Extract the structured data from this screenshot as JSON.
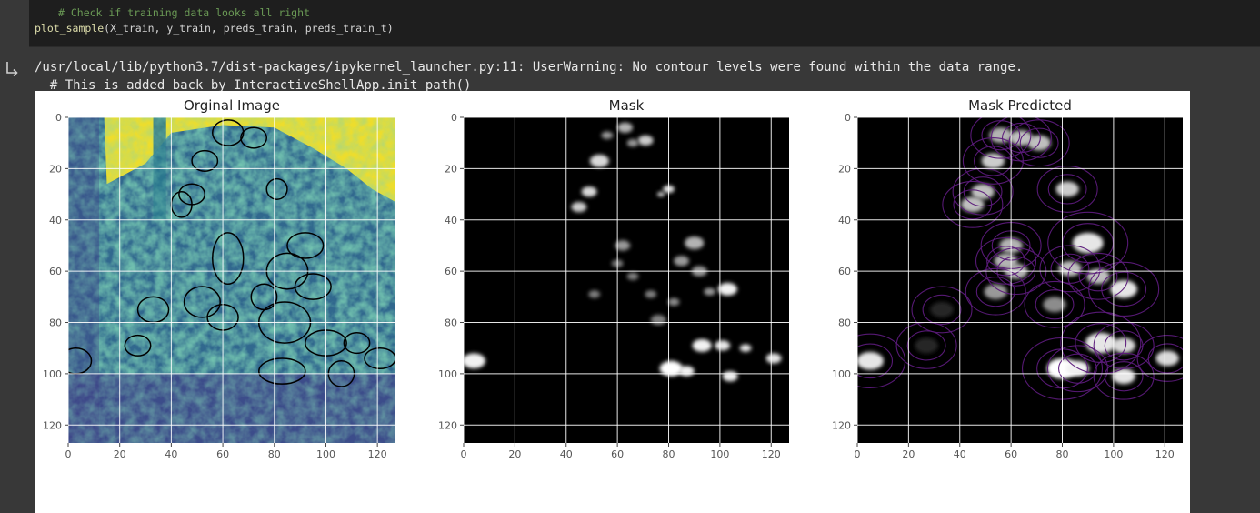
{
  "code": {
    "comment": "# Check if training data looks all right",
    "call_fn": "plot_sample",
    "call_args": "(X_train, y_train, preds_train, preds_train_t)"
  },
  "output": {
    "icon": "output-arrow-icon",
    "warning_line": "/usr/local/lib/python3.7/dist-packages/ipykernel_launcher.py:11: UserWarning: No contour levels were found within the data range.",
    "trace_line": "  # This is added back by InteractiveShellApp.init_path()"
  },
  "colors": {
    "cell_bg": "#1e1e1e",
    "output_bg": "#383838",
    "comment": "#6a9955",
    "viridis_low": "#440154",
    "viridis_mid": "#31688e",
    "viridis_high": "#fde725",
    "contour_purple": "#5b1a7a"
  },
  "chart_data": [
    {
      "type": "heatmap",
      "title": "Orginal Image",
      "colormap": "viridis",
      "xlim": [
        0,
        127
      ],
      "ylim": [
        127,
        0
      ],
      "xticks": [
        0,
        20,
        40,
        60,
        80,
        100,
        120
      ],
      "yticks": [
        0,
        20,
        40,
        60,
        80,
        100,
        120
      ],
      "grid": true,
      "contour_blobs": [
        {
          "x": 62,
          "y": 6,
          "rx": 6,
          "ry": 5
        },
        {
          "x": 72,
          "y": 8,
          "rx": 5,
          "ry": 4
        },
        {
          "x": 53,
          "y": 17,
          "rx": 5,
          "ry": 4
        },
        {
          "x": 48,
          "y": 30,
          "rx": 5,
          "ry": 4
        },
        {
          "x": 44,
          "y": 34,
          "rx": 4,
          "ry": 5
        },
        {
          "x": 81,
          "y": 28,
          "rx": 4,
          "ry": 4
        },
        {
          "x": 62,
          "y": 55,
          "rx": 6,
          "ry": 10
        },
        {
          "x": 92,
          "y": 50,
          "rx": 7,
          "ry": 5
        },
        {
          "x": 85,
          "y": 60,
          "rx": 8,
          "ry": 7
        },
        {
          "x": 52,
          "y": 72,
          "rx": 7,
          "ry": 6
        },
        {
          "x": 60,
          "y": 78,
          "rx": 6,
          "ry": 5
        },
        {
          "x": 33,
          "y": 75,
          "rx": 6,
          "ry": 5
        },
        {
          "x": 27,
          "y": 89,
          "rx": 5,
          "ry": 4
        },
        {
          "x": 95,
          "y": 66,
          "rx": 7,
          "ry": 5
        },
        {
          "x": 84,
          "y": 80,
          "rx": 10,
          "ry": 8
        },
        {
          "x": 100,
          "y": 88,
          "rx": 8,
          "ry": 5
        },
        {
          "x": 112,
          "y": 88,
          "rx": 5,
          "ry": 4
        },
        {
          "x": 121,
          "y": 94,
          "rx": 6,
          "ry": 4
        },
        {
          "x": 83,
          "y": 99,
          "rx": 9,
          "ry": 5
        },
        {
          "x": 106,
          "y": 100,
          "rx": 5,
          "ry": 5
        },
        {
          "x": 3,
          "y": 95,
          "rx": 6,
          "ry": 5
        },
        {
          "x": 76,
          "y": 70,
          "rx": 5,
          "ry": 5
        }
      ]
    },
    {
      "type": "heatmap",
      "title": "Mask",
      "colormap": "gray",
      "xlim": [
        0,
        127
      ],
      "ylim": [
        127,
        0
      ],
      "xticks": [
        0,
        20,
        40,
        60,
        80,
        100,
        120
      ],
      "yticks": [
        0,
        20,
        40,
        60,
        80,
        100,
        120
      ],
      "grid": true,
      "blobs": [
        {
          "x": 63,
          "y": 4,
          "r": 2,
          "v": 0.7
        },
        {
          "x": 71,
          "y": 9,
          "r": 2,
          "v": 0.8
        },
        {
          "x": 56,
          "y": 7,
          "r": 1.5,
          "v": 0.6
        },
        {
          "x": 66,
          "y": 10,
          "r": 1.5,
          "v": 0.6
        },
        {
          "x": 53,
          "y": 17,
          "r": 2.5,
          "v": 0.85
        },
        {
          "x": 49,
          "y": 29,
          "r": 2,
          "v": 0.85
        },
        {
          "x": 45,
          "y": 35,
          "r": 2,
          "v": 0.8
        },
        {
          "x": 80,
          "y": 28,
          "r": 1.5,
          "v": 0.9
        },
        {
          "x": 77,
          "y": 30,
          "r": 1,
          "v": 0.8
        },
        {
          "x": 62,
          "y": 50,
          "r": 2,
          "v": 0.6
        },
        {
          "x": 60,
          "y": 57,
          "r": 1.5,
          "v": 0.5
        },
        {
          "x": 66,
          "y": 62,
          "r": 1.5,
          "v": 0.5
        },
        {
          "x": 90,
          "y": 49,
          "r": 2.5,
          "v": 0.7
        },
        {
          "x": 85,
          "y": 56,
          "r": 2,
          "v": 0.6
        },
        {
          "x": 92,
          "y": 60,
          "r": 2,
          "v": 0.6
        },
        {
          "x": 103,
          "y": 67,
          "r": 2.5,
          "v": 0.95
        },
        {
          "x": 96,
          "y": 68,
          "r": 1.5,
          "v": 0.6
        },
        {
          "x": 82,
          "y": 72,
          "r": 1.5,
          "v": 0.55
        },
        {
          "x": 51,
          "y": 69,
          "r": 1.5,
          "v": 0.5
        },
        {
          "x": 76,
          "y": 79,
          "r": 2,
          "v": 0.5
        },
        {
          "x": 93,
          "y": 89,
          "r": 2.5,
          "v": 0.95
        },
        {
          "x": 101,
          "y": 89,
          "r": 2,
          "v": 0.9
        },
        {
          "x": 110,
          "y": 90,
          "r": 1.5,
          "v": 0.9
        },
        {
          "x": 4,
          "y": 95,
          "r": 3,
          "v": 0.95
        },
        {
          "x": 81,
          "y": 98,
          "r": 3,
          "v": 1.0
        },
        {
          "x": 87,
          "y": 99,
          "r": 2,
          "v": 0.95
        },
        {
          "x": 104,
          "y": 101,
          "r": 2,
          "v": 0.95
        },
        {
          "x": 121,
          "y": 94,
          "r": 2,
          "v": 0.9
        },
        {
          "x": 73,
          "y": 69,
          "r": 1.5,
          "v": 0.5
        }
      ]
    },
    {
      "type": "heatmap",
      "title": "Mask Predicted",
      "colormap": "gray",
      "contour_color": "purple",
      "xlim": [
        0,
        127
      ],
      "ylim": [
        127,
        0
      ],
      "xticks": [
        0,
        20,
        40,
        60,
        80,
        100,
        120
      ],
      "yticks": [
        0,
        20,
        40,
        60,
        80,
        100,
        120
      ],
      "grid": true,
      "blobs": [
        {
          "x": 56,
          "y": 7,
          "r": 3,
          "v": 0.7
        },
        {
          "x": 64,
          "y": 8,
          "r": 3,
          "v": 0.75
        },
        {
          "x": 71,
          "y": 10,
          "r": 3,
          "v": 0.75
        },
        {
          "x": 53,
          "y": 17,
          "r": 3,
          "v": 0.8
        },
        {
          "x": 49,
          "y": 29,
          "r": 3,
          "v": 0.75
        },
        {
          "x": 45,
          "y": 34,
          "r": 3,
          "v": 0.75
        },
        {
          "x": 82,
          "y": 28,
          "r": 3,
          "v": 0.8
        },
        {
          "x": 60,
          "y": 50,
          "r": 3,
          "v": 0.7
        },
        {
          "x": 58,
          "y": 56,
          "r": 3,
          "v": 0.7
        },
        {
          "x": 62,
          "y": 60,
          "r": 3,
          "v": 0.7
        },
        {
          "x": 90,
          "y": 49,
          "r": 4,
          "v": 0.9
        },
        {
          "x": 83,
          "y": 59,
          "r": 3,
          "v": 0.75
        },
        {
          "x": 94,
          "y": 62,
          "r": 3,
          "v": 0.75
        },
        {
          "x": 104,
          "y": 67,
          "r": 3.5,
          "v": 0.9
        },
        {
          "x": 77,
          "y": 73,
          "r": 3,
          "v": 0.55
        },
        {
          "x": 54,
          "y": 68,
          "r": 3,
          "v": 0.6
        },
        {
          "x": 95,
          "y": 88,
          "r": 4,
          "v": 0.9
        },
        {
          "x": 104,
          "y": 89,
          "r": 3,
          "v": 0.85
        },
        {
          "x": 5,
          "y": 95,
          "r": 3.5,
          "v": 0.9
        },
        {
          "x": 80,
          "y": 98,
          "r": 4,
          "v": 1.0
        },
        {
          "x": 86,
          "y": 98,
          "r": 3,
          "v": 0.95
        },
        {
          "x": 104,
          "y": 101,
          "r": 3,
          "v": 0.9
        },
        {
          "x": 121,
          "y": 94,
          "r": 3,
          "v": 0.85
        },
        {
          "x": 33,
          "y": 75,
          "r": 3,
          "v": 0.15
        },
        {
          "x": 27,
          "y": 89,
          "r": 3,
          "v": 0.15
        }
      ]
    }
  ]
}
